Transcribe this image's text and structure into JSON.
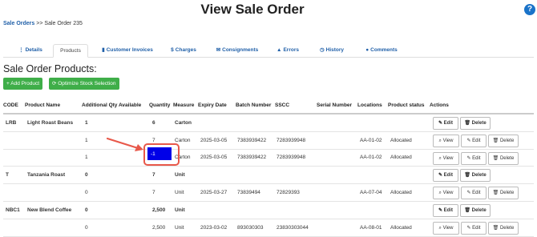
{
  "header": {
    "title": "View Sale Order",
    "help_icon": "?"
  },
  "breadcrumb": {
    "link": "Sale Orders",
    "separator": ">>",
    "current": "Sale Order 235"
  },
  "tabs": [
    {
      "icon": "⋮",
      "label": "Details"
    },
    {
      "icon": "",
      "label": "Products"
    },
    {
      "icon": "▮",
      "label": "Customer Invoices"
    },
    {
      "icon": "$",
      "label": "Charges"
    },
    {
      "icon": "✉",
      "label": "Consignments"
    },
    {
      "icon": "▲",
      "label": "Errors"
    },
    {
      "icon": "◷",
      "label": "History"
    },
    {
      "icon": "●",
      "label": "Comments"
    }
  ],
  "section": {
    "title": "Sale Order Products:",
    "add_button": "+ Add Product",
    "optimize_button": "⟳ Optimize Stock Selection"
  },
  "table": {
    "headers": [
      "CODE",
      "Product Name",
      "Additional Qty Available",
      "Quantity",
      "Measure",
      "Expiry Date",
      "Batch Number",
      "SSCC",
      "Serial Number",
      "Locations",
      "Product status",
      "Actions"
    ],
    "rows": [
      {
        "type": "product",
        "code": "LRB",
        "name": "Light Roast Beans",
        "addl": "1",
        "qty": "6",
        "measure": "Carton",
        "expiry": "",
        "batch": "",
        "sscc": "",
        "serial": "",
        "location": "",
        "status": ""
      },
      {
        "type": "line",
        "code": "",
        "name": "",
        "addl": "1",
        "qty": "7",
        "measure": "Carton",
        "expiry": "2025-03-05",
        "batch": "7383939422",
        "sscc": "7283939948",
        "serial": "",
        "location": "AA-01-02",
        "status": "Allocated"
      },
      {
        "type": "line",
        "code": "",
        "name": "",
        "addl": "1",
        "qty": "",
        "measure": "Carton",
        "expiry": "2025-03-05",
        "batch": "7383939422",
        "sscc": "7283939948",
        "serial": "",
        "location": "AA-01-02",
        "status": "Allocated"
      },
      {
        "type": "product",
        "code": "T",
        "name": "Tanzania Roast",
        "addl": "0",
        "qty": "7",
        "measure": "Unit",
        "expiry": "",
        "batch": "",
        "sscc": "",
        "serial": "",
        "location": "",
        "status": ""
      },
      {
        "type": "line",
        "code": "",
        "name": "",
        "addl": "0",
        "qty": "7",
        "measure": "Unit",
        "expiry": "2025-03-27",
        "batch": "73839494",
        "sscc": "72829393",
        "serial": "",
        "location": "AA-07-04",
        "status": "Allocated"
      },
      {
        "type": "product",
        "code": "NBC1",
        "name": "New Blend Coffee",
        "addl": "0",
        "qty": "2,500",
        "measure": "Unit",
        "expiry": "",
        "batch": "",
        "sscc": "",
        "serial": "",
        "location": "",
        "status": ""
      },
      {
        "type": "line",
        "code": "",
        "name": "",
        "addl": "0",
        "qty": "2,500",
        "measure": "Unit",
        "expiry": "2023-03-02",
        "batch": "893030303",
        "sscc": "23830303044",
        "serial": "",
        "location": "AA-08-01",
        "status": "Allocated"
      }
    ],
    "actions": {
      "view": "View",
      "edit": "Edit",
      "delete": "Delete"
    }
  },
  "quantity_input": {
    "value": "-1"
  },
  "colors": {
    "link": "#1f5fa8",
    "green": "#3fae49",
    "input_selected": "#0000e8",
    "highlight": "#e8584a"
  }
}
